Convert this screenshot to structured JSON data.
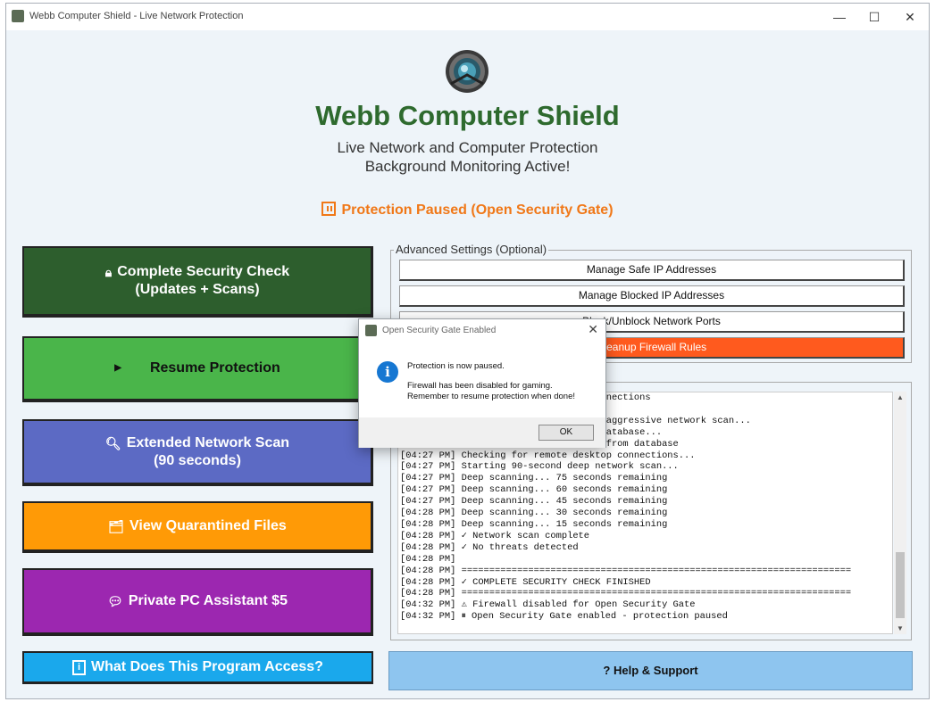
{
  "window": {
    "title": "Webb Computer Shield - Live Network Protection",
    "min": "—",
    "max": "☐",
    "close": "✕"
  },
  "header": {
    "title": "Webb Computer Shield",
    "subtitle1": "Live Network and Computer Protection",
    "subtitle2": "Background Monitoring Active!",
    "status": "Protection Paused (Open Security Gate)"
  },
  "buttons": {
    "security_check_l1": "Complete Security Check",
    "security_check_l2": "(Updates + Scans)",
    "resume": "Resume Protection",
    "extended_l1": "Extended Network Scan",
    "extended_l2": "(90 seconds)",
    "quarantine": "View Quarantined Files",
    "assistant": "Private PC Assistant $5",
    "access": "What Does This Program Access?",
    "help": "Help & Support",
    "colors": {
      "security": "#2d5e2d",
      "resume": "#4ab54a",
      "extended": "#5c6ac4",
      "quarantine": "#ff9a06",
      "assistant": "#9c27b0",
      "access": "#1aa8ec"
    }
  },
  "advanced": {
    "label": "Advanced Settings (Optional)",
    "items": [
      "Manage Safe IP Addresses",
      "Manage Blocked IP Addresses",
      "Block/Unblock Network Ports",
      "Cleanup Firewall Rules"
    ]
  },
  "log": {
    "lines": [
      "                                   onnections",
      "",
      "                                   d aggressive network scan...",
      "                                    database...",
      "                                   s from database",
      "[04:27 PM] Checking for remote desktop connections...",
      "[04:27 PM] Starting 90-second deep network scan...",
      "[04:27 PM] Deep scanning... 75 seconds remaining",
      "[04:27 PM] Deep scanning... 60 seconds remaining",
      "[04:27 PM] Deep scanning... 45 seconds remaining",
      "[04:28 PM] Deep scanning... 30 seconds remaining",
      "[04:28 PM] Deep scanning... 15 seconds remaining",
      "[04:28 PM] ✓ Network scan complete",
      "[04:28 PM] ✓ No threats detected",
      "[04:28 PM]",
      "[04:28 PM] ======================================================================",
      "[04:28 PM] ✓ COMPLETE SECURITY CHECK FINISHED",
      "[04:28 PM] ======================================================================",
      "[04:32 PM] ⚠ Firewall disabled for Open Security Gate",
      "[04:32 PM] ⏸ Open Security Gate enabled - protection paused"
    ]
  },
  "dialog": {
    "title": "Open Security Gate Enabled",
    "line1": "Protection is now paused.",
    "line2": "Firewall has been disabled for gaming.",
    "line3": "Remember to resume protection when done!",
    "ok": "OK"
  }
}
